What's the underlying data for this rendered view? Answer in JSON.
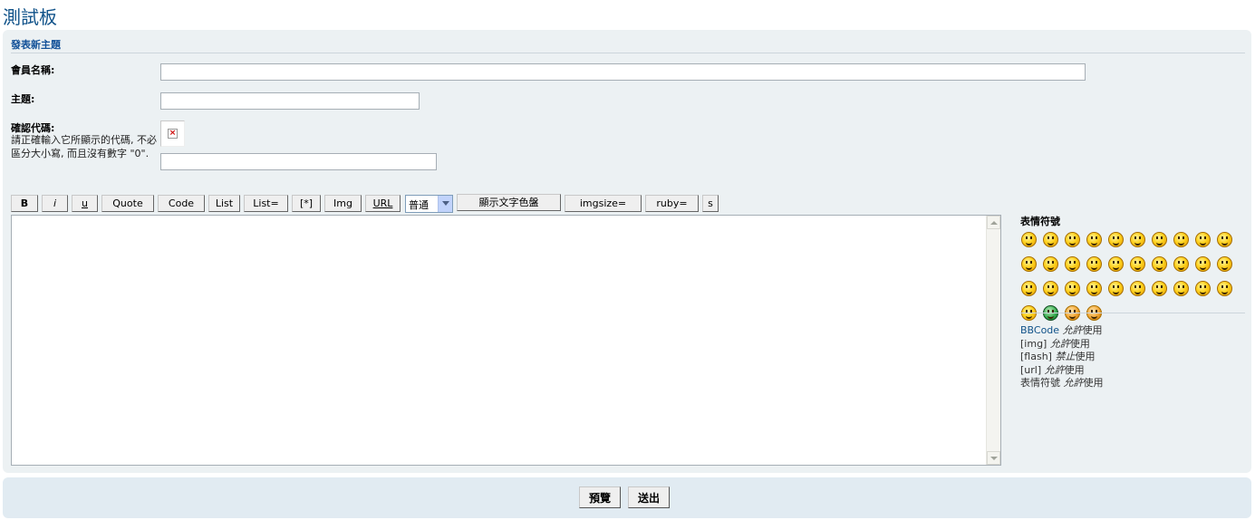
{
  "page": {
    "title": "測試板"
  },
  "form": {
    "heading": "發表新主題",
    "name_label": "會員名稱:",
    "name_value": "",
    "subject_label": "主題:",
    "subject_value": "",
    "confirm_label": "確認代碼:",
    "confirm_explain": "請正確輸入它所顯示的代碼, 不必區分大小寫, 而且沒有數字 \"0\".",
    "captcha_broken_icon": "×",
    "confirm_value": ""
  },
  "toolbar": {
    "buttons": [
      "B",
      "i",
      "u",
      "Quote",
      "Code",
      "List",
      "List=",
      "[*]",
      "Img",
      "URL"
    ],
    "font_size_selected": "普通",
    "color_button": "顯示文字色盤",
    "extra_buttons": [
      "imgsize=",
      "ruby=",
      "s"
    ]
  },
  "editor": {
    "content": ""
  },
  "smilies": {
    "title": "表情符號",
    "count": 34
  },
  "options": {
    "bbcode_label": "BBCode",
    "bbcode_status": "允許",
    "bbcode_suffix": "使用",
    "img_label": "[img]",
    "img_status": "允許",
    "img_suffix": "使用",
    "flash_label": "[flash]",
    "flash_status": "禁止",
    "flash_suffix": "使用",
    "url_label": "[url]",
    "url_status": "允許",
    "url_suffix": "使用",
    "smilies_label": "表情符號",
    "smilies_status": "允許",
    "smilies_suffix": "使用"
  },
  "footer": {
    "preview_button": "預覽",
    "submit_button": "送出"
  }
}
